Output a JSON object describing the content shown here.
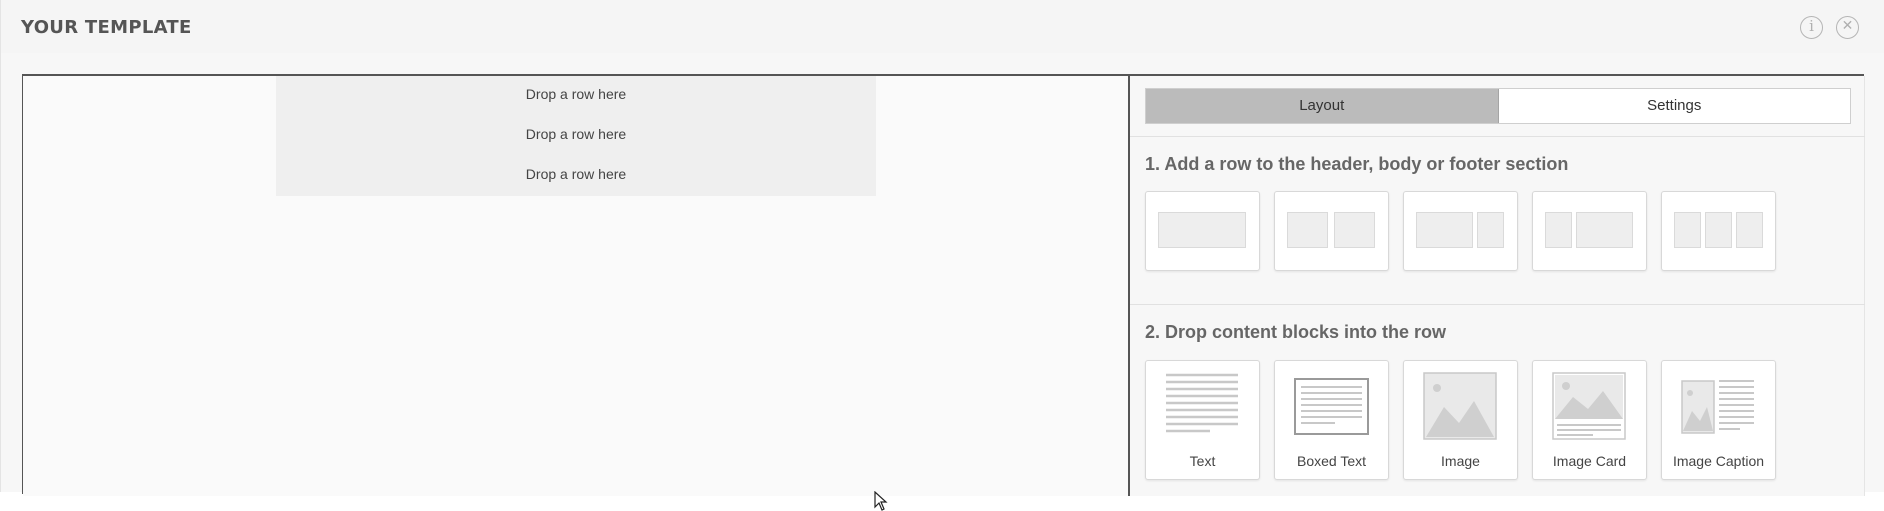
{
  "header": {
    "title": "YOUR TEMPLATE",
    "icons": [
      "info-icon",
      "close-icon"
    ]
  },
  "canvas": {
    "drop_rows": [
      "Drop a row here",
      "Drop a row here",
      "Drop a row here"
    ]
  },
  "panel": {
    "tabs": [
      {
        "label": "Layout",
        "active": true
      },
      {
        "label": "Settings",
        "active": false
      }
    ],
    "section1_title": "1. Add a row to the header, body or footer section",
    "row_layouts": [
      "single-column",
      "two-equal-columns",
      "wide-left-narrow-right",
      "narrow-left-wide-right",
      "three-equal-columns"
    ],
    "section2_title": "2. Drop content blocks into the row",
    "content_blocks": [
      {
        "label": "Text",
        "icon": "text-lines-icon"
      },
      {
        "label": "Boxed Text",
        "icon": "boxed-text-icon"
      },
      {
        "label": "Image",
        "icon": "image-icon"
      },
      {
        "label": "Image Card",
        "icon": "image-card-icon"
      },
      {
        "label": "Image Caption",
        "icon": "image-caption-icon"
      }
    ]
  },
  "colors": {
    "active_tab": "#bbbbbb",
    "drop_area": "#efefef",
    "panel_bg": "#f7f7f7"
  }
}
